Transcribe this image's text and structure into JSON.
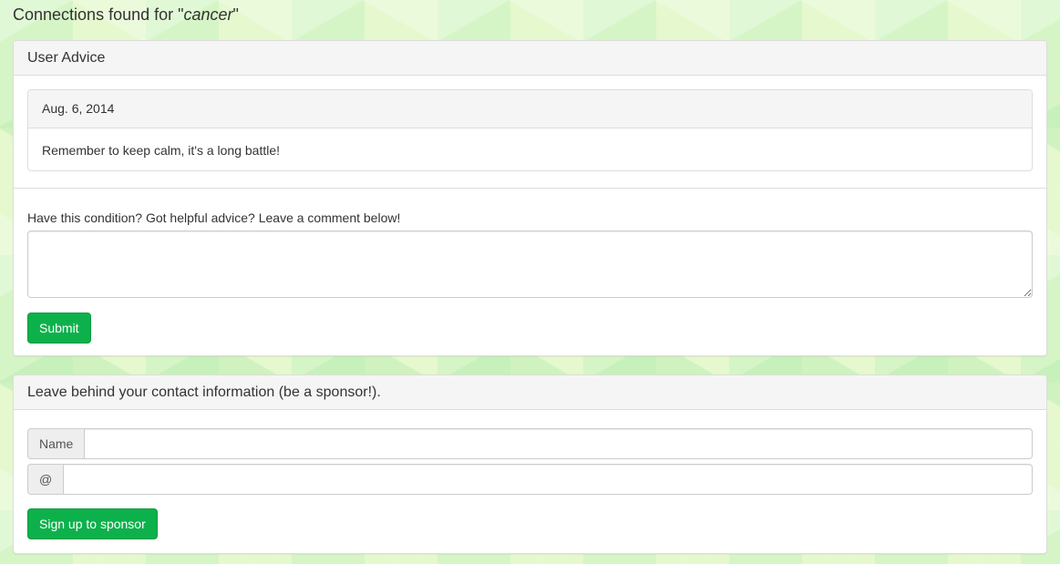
{
  "heading": {
    "prefix": "Connections found for \"",
    "query": "cancer",
    "suffix": "\""
  },
  "advice_panel": {
    "title": "User Advice",
    "entries": [
      {
        "date": "Aug. 6, 2014",
        "text": "Remember to keep calm, it's a long battle!"
      }
    ],
    "comment_prompt": "Have this condition? Got helpful advice? Leave a comment below!",
    "comment_value": "",
    "submit_label": "Submit"
  },
  "sponsor_panel": {
    "title": "Leave behind your contact information (be a sponsor!).",
    "name_addon": "Name",
    "name_value": "",
    "email_addon": "@",
    "email_value": "",
    "signup_label": "Sign up to sponsor"
  },
  "colors": {
    "button_green": "#0db14b",
    "background_green": "#d6f5c6"
  }
}
